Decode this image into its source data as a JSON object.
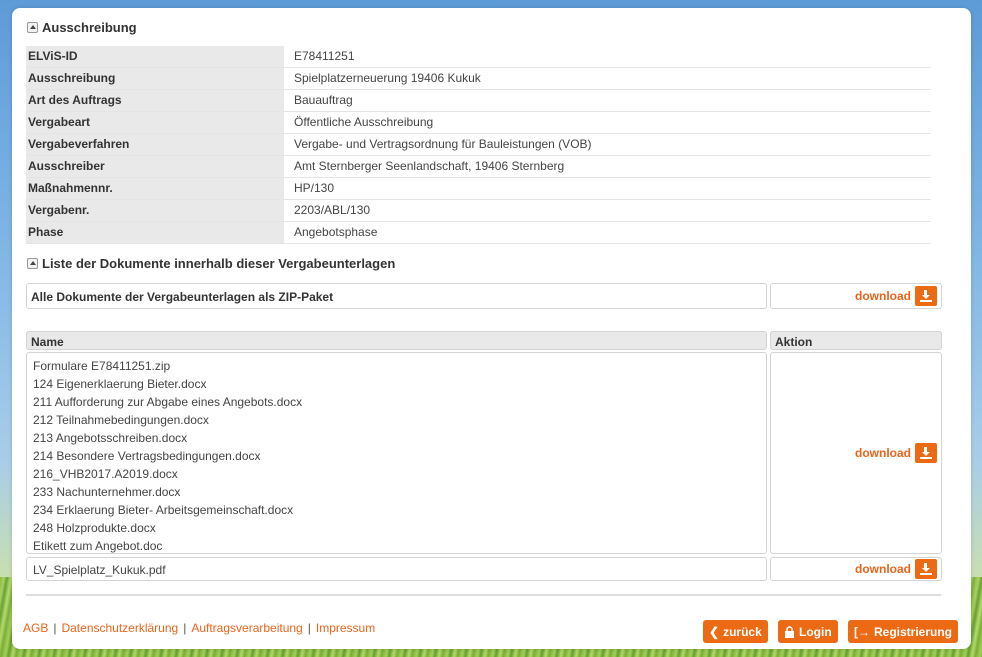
{
  "section1": {
    "title": "Ausschreibung"
  },
  "info": [
    {
      "key": "ELViS-ID",
      "value": "E78411251"
    },
    {
      "key": "Ausschreibung",
      "value": "Spielplatzerneuerung 19406 Kukuk"
    },
    {
      "key": "Art des Auftrags",
      "value": "Bauauftrag"
    },
    {
      "key": "Vergabeart",
      "value": "Öffentliche Ausschreibung"
    },
    {
      "key": "Vergabeverfahren",
      "value": "Vergabe- und Vertragsordnung für Bauleistungen (VOB)"
    },
    {
      "key": "Ausschreiber",
      "value": "Amt Sternberger Seenlandschaft, 19406 Sternberg"
    },
    {
      "key": "Maßnahmennr.",
      "value": "HP/130"
    },
    {
      "key": "Vergabenr.",
      "value": "2203/ABL/130"
    },
    {
      "key": "Phase",
      "value": "Angebotsphase"
    }
  ],
  "section2": {
    "title": "Liste der Dokumente innerhalb dieser Vergabeunterlagen"
  },
  "zip": {
    "label": "Alle Dokumente der Vergabeunterlagen als ZIP-Paket",
    "download": "download"
  },
  "table": {
    "col_name": "Name",
    "col_action": "Aktion",
    "files": [
      "Formulare E78411251.zip",
      "124 Eigenerklaerung Bieter.docx",
      "211 Aufforderung zur Abgabe eines Angebots.docx",
      "212 Teilnahmebedingungen.docx",
      "213 Angebotsschreiben.docx",
      "214 Besondere Vertragsbedingungen.docx",
      "216_VHB2017.A2019.docx",
      "233 Nachunternehmer.docx",
      "234 Erklaerung Bieter- Arbeitsgemeinschaft.docx",
      "248 Holzprodukte.docx",
      "Etikett zum Angebot.doc"
    ],
    "group_download": "download",
    "lv_file": "LV_Spielplatz_Kukuk.pdf",
    "lv_download": "download"
  },
  "footer": {
    "links": [
      "AGB",
      "Datenschutzerklärung",
      "Auftragsverarbeitung",
      "Impressum"
    ],
    "separator": "|",
    "back": "zurück",
    "login": "Login",
    "register": "Registrierung"
  },
  "colors": {
    "accent": "#ec6a14",
    "label_bg": "#e9e9e9"
  },
  "icons": [
    "collapse-icon",
    "download-icon",
    "chevron-left-icon",
    "lock-icon",
    "register-icon"
  ]
}
